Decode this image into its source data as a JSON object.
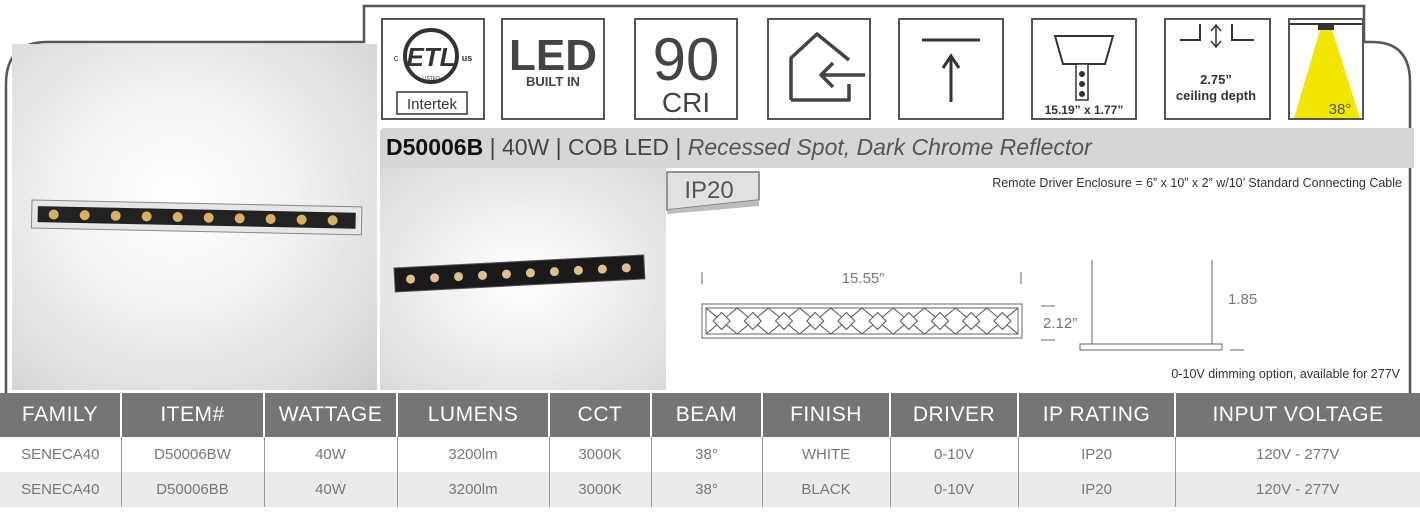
{
  "certifications": {
    "etl_mark": "ETL",
    "etl_c": "c",
    "etl_us": "us",
    "etl_listed": "LISTED",
    "etl_brand": "Intertek",
    "led_big": "LED",
    "led_small": "BUILT IN",
    "cri_value": "90",
    "cri_label": "CRI",
    "dimensions_label": "15.19” x 1.77”",
    "ceiling_value": "2.75”",
    "ceiling_label": "ceiling depth",
    "beam_angle": "38°"
  },
  "title": {
    "code": "D50006B",
    "sep1": " | ",
    "wattage": "40W",
    "sep2": " | ",
    "type": "COB LED",
    "sep3": " | ",
    "description": "Recessed Spot, Dark Chrome Reflector"
  },
  "ip_badge": "IP20",
  "remote_driver": "Remote Driver Enclosure = 6” x 10” x 2” w/10’ Standard Connecting Cable",
  "drawing": {
    "length": "15.55”",
    "width": "2.12”",
    "height": "1.85”"
  },
  "dimming_note": "0-10V dimming option, available for 277V",
  "table": {
    "headers": [
      "FAMILY",
      "ITEM#",
      "WATTAGE",
      "LUMENS",
      "CCT",
      "BEAM",
      "FINISH",
      "DRIVER",
      "IP RATING",
      "INPUT VOLTAGE"
    ],
    "rows": [
      [
        "SENECA40",
        "D50006BW",
        "40W",
        "3200lm",
        "3000K",
        "38°",
        "WHITE",
        "0-10V",
        "IP20",
        "120V - 277V"
      ],
      [
        "SENECA40",
        "D50006BB",
        "40W",
        "3200lm",
        "3000K",
        "38°",
        "BLACK",
        "0-10V",
        "IP20",
        "120V - 277V"
      ]
    ]
  },
  "colors": {
    "header_bg": "#757575",
    "title_bar_bg": "#d6d6d6",
    "beam_yellow": "#f2e600"
  }
}
